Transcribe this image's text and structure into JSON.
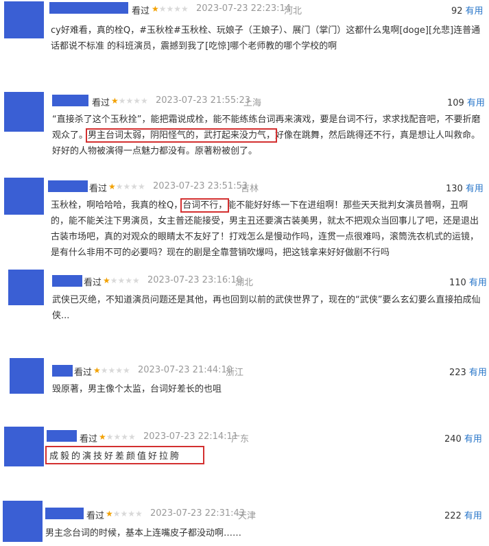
{
  "reviews": [
    {
      "seen": "看过",
      "rating": 1,
      "time": "2023-07-23 22:23:14",
      "location": "河北",
      "votes": "92",
      "useful": "有用",
      "text": "cy好难看，真的栓Q，#玉秋栓#玉秋栓、玩娘子（王娘子）、展门（掌门）这都什么鬼啊[doge][允悲]连普通话都说不标准 的科班演员，震撼到我了[吃惊]哪个老师教的哪个学校的啊"
    },
    {
      "seen": "看过",
      "rating": 1,
      "time": "2023-07-23 21:55:23",
      "location": "上海",
      "votes": "109",
      "useful": "有用",
      "text_before": "“直接杀了这个玉秋拴”，能把霜说成栓，能不能练练台词再来演戏，要是台词不行，求求找配音吧，不要折磨观众了。",
      "text_highlight": "男主台词太弱，阴阳怪气的，武打起来没力气，",
      "text_after": "好像在跳舞，然后跳得还不行，真是想让人叫救命。好好的人物被演得一点魅力都没有。原著粉被创了。"
    },
    {
      "seen": "看过",
      "rating": 1,
      "time": "2023-07-23 23:51:53",
      "location": "吉林",
      "votes": "130",
      "useful": "有用",
      "text_before": "玉秋栓，啊哈哈哈，我真的栓Q，",
      "text_highlight": "台词不行，",
      "text_after": "能不能好好练一下在进组啊！那些天天批判女演员普啊，丑啊的，能不能关注下男演员，女主普还能接受，男主丑还要演古装美男，就太不把观众当回事儿了吧，还是退出古装市场吧，真的对观众的眼睛太不友好了！打戏怎么是慢动作吗，连贯一点很难吗，滚筒洗衣机式的运镜，是有什么非用不可的必要吗？现在的剧是全靠营销吹爆吗，把这钱拿来好好做剧不行吗"
    },
    {
      "seen": "看过",
      "rating": 1,
      "time": "2023-07-23 23:16:10",
      "location": "湖北",
      "votes": "110",
      "useful": "有用",
      "text": "武侠已灭绝，不知道演员问题还是其他，再也回到以前的武侠世界了，现在的“武侠”要么玄幻要么直接拍成仙侠..."
    },
    {
      "seen": "看过",
      "rating": 1,
      "time": "2023-07-23 21:44:10",
      "location": "浙江",
      "votes": "223",
      "useful": "有用",
      "text": "毁原著，男主像个太监，台词好差长的也咀"
    },
    {
      "seen": "看过",
      "rating": 1,
      "time": "2023-07-23 22:14:11",
      "location": "广东",
      "votes": "240",
      "useful": "有用",
      "text": "成毅的演技好差颜值好拉胯"
    },
    {
      "seen": "看过",
      "rating": 1,
      "time": "2023-07-23 22:31:43",
      "location": "天津",
      "votes": "222",
      "useful": "有用",
      "text": "男主念台词的时候，基本上连嘴皮子都没动啊……"
    }
  ],
  "colors": {
    "avatar": "#3a5fd4",
    "star": "#f2a100",
    "useful": "#2775c9",
    "highlight": "#d32f2f"
  }
}
